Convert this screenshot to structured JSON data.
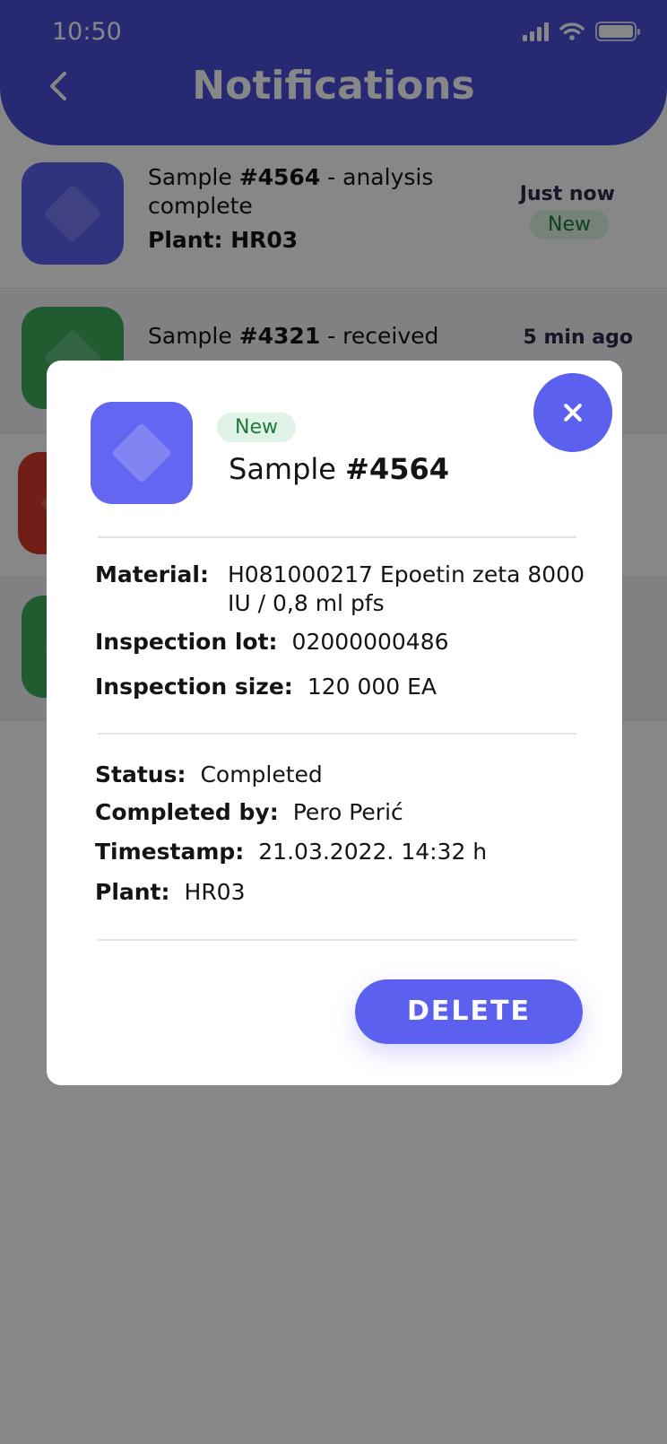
{
  "status_bar": {
    "time": "10:50"
  },
  "header": {
    "title": "Notifications"
  },
  "notifications": [
    {
      "sample_prefix": "Sample ",
      "sample_id": "#4564",
      "suffix": " - analysis complete",
      "plant": "Plant: HR03",
      "time": "Just now",
      "badge": "New",
      "icon_color": "#5b60ef"
    },
    {
      "sample_prefix": "Sample ",
      "sample_id": "#4321",
      "suffix": " - received",
      "time": "5 min ago",
      "icon_color": "#3fae5c"
    },
    {
      "icon_color": "#d43a2e"
    },
    {
      "icon_color": "#3fae5c"
    }
  ],
  "modal": {
    "badge": "New",
    "title_prefix": "Sample ",
    "title_id": "#4564",
    "material_label": "Material:",
    "material_value": "H081000217 Epoetin zeta 8000 IU / 0,8 ml pfs",
    "inspection_lot_label": "Inspection lot:",
    "inspection_lot_value": "02000000486",
    "inspection_size_label": "Inspection size:",
    "inspection_size_value": "120 000 EA",
    "status_label": "Status:",
    "status_value": "Completed",
    "completed_by_label": "Completed by:",
    "completed_by_value": "Pero Perić",
    "timestamp_label": "Timestamp:",
    "timestamp_value": "21.03.2022. 14:32 h",
    "plant_label": "Plant:",
    "plant_value": "HR03",
    "delete_label": "DELETE"
  }
}
